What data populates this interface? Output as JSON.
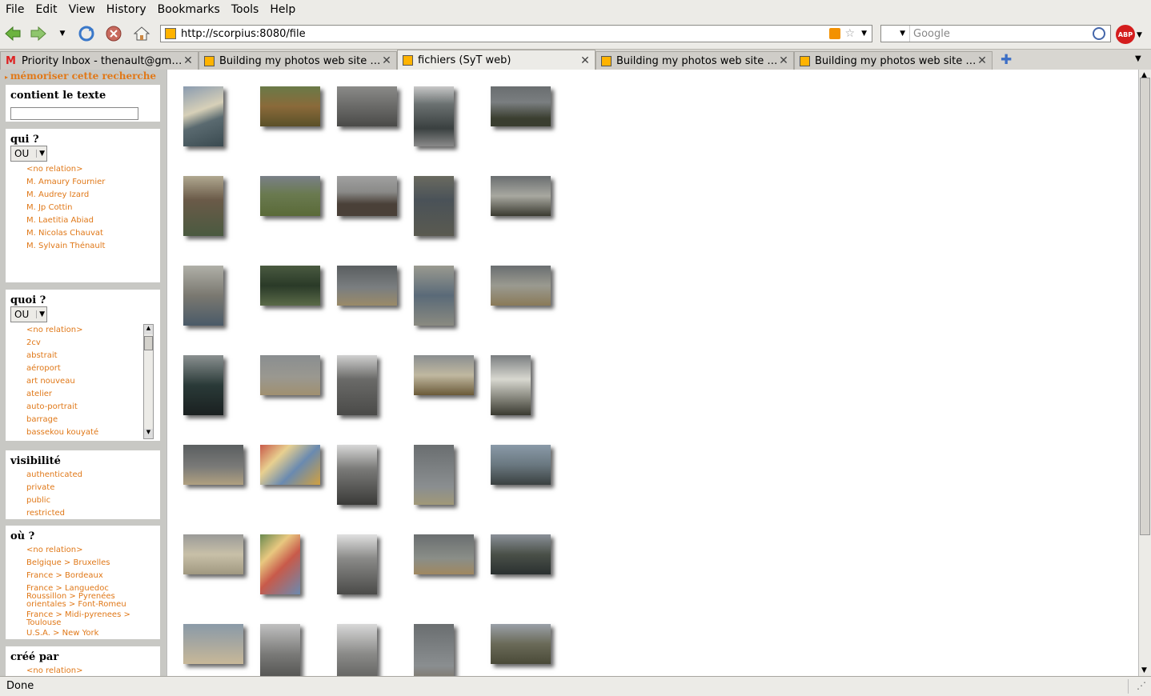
{
  "menu": [
    "File",
    "Edit",
    "View",
    "History",
    "Bookmarks",
    "Tools",
    "Help"
  ],
  "menu_underline": [
    "F",
    "E",
    "V",
    "s",
    "B",
    "T",
    "H"
  ],
  "url": "http://scorpius:8080/file",
  "search_placeholder": "Google",
  "abp_label": "ABP",
  "tabs": [
    {
      "title": "Priority Inbox - thenault@gm…",
      "icon": "gmail-icon"
    },
    {
      "title": "Building my photos web site …",
      "icon": "cube-icon"
    },
    {
      "title": "fichiers (SyT web)",
      "icon": "cube-icon"
    },
    {
      "title": "Building my photos web site …",
      "icon": "cube-icon"
    },
    {
      "title": "Building my photos web site …",
      "icon": "cube-icon"
    }
  ],
  "sidebar": {
    "memo": "mémoriser cette recherche",
    "text_filter": {
      "title": "contient le texte",
      "value": ""
    },
    "qui": {
      "title": "qui ?",
      "op": "OU",
      "items": [
        "<no relation>",
        "M. Amaury Fournier",
        "M. Audrey Izard",
        "M. Jp Cottin",
        "M. Laetitia Abiad",
        "M. Nicolas Chauvat",
        "M. Sylvain Thénault"
      ]
    },
    "quoi": {
      "title": "quoi ?",
      "op": "OU",
      "items": [
        "<no relation>",
        "2cv",
        "abstrait",
        "aéroport",
        "art nouveau",
        "atelier",
        "auto-portrait",
        "barrage",
        "bassekou kouyaté"
      ]
    },
    "visibilite": {
      "title": "visibilité",
      "items": [
        "authenticated",
        "private",
        "public",
        "restricted"
      ]
    },
    "ou": {
      "title": "où ?",
      "items": [
        "<no relation>",
        "Belgique > Bruxelles",
        "France > Bordeaux",
        "France > Languedoc Roussillon > Pyrenées orientales > Font-Romeu",
        "France > Midi-pyrenees > Toulouse",
        "U.S.A. > New York"
      ]
    },
    "cree_par": {
      "title": "créé par",
      "items": [
        "<no relation>"
      ]
    }
  },
  "status": "Done",
  "colors": {
    "link": "#e07818",
    "chrome": "#ecebe7"
  }
}
